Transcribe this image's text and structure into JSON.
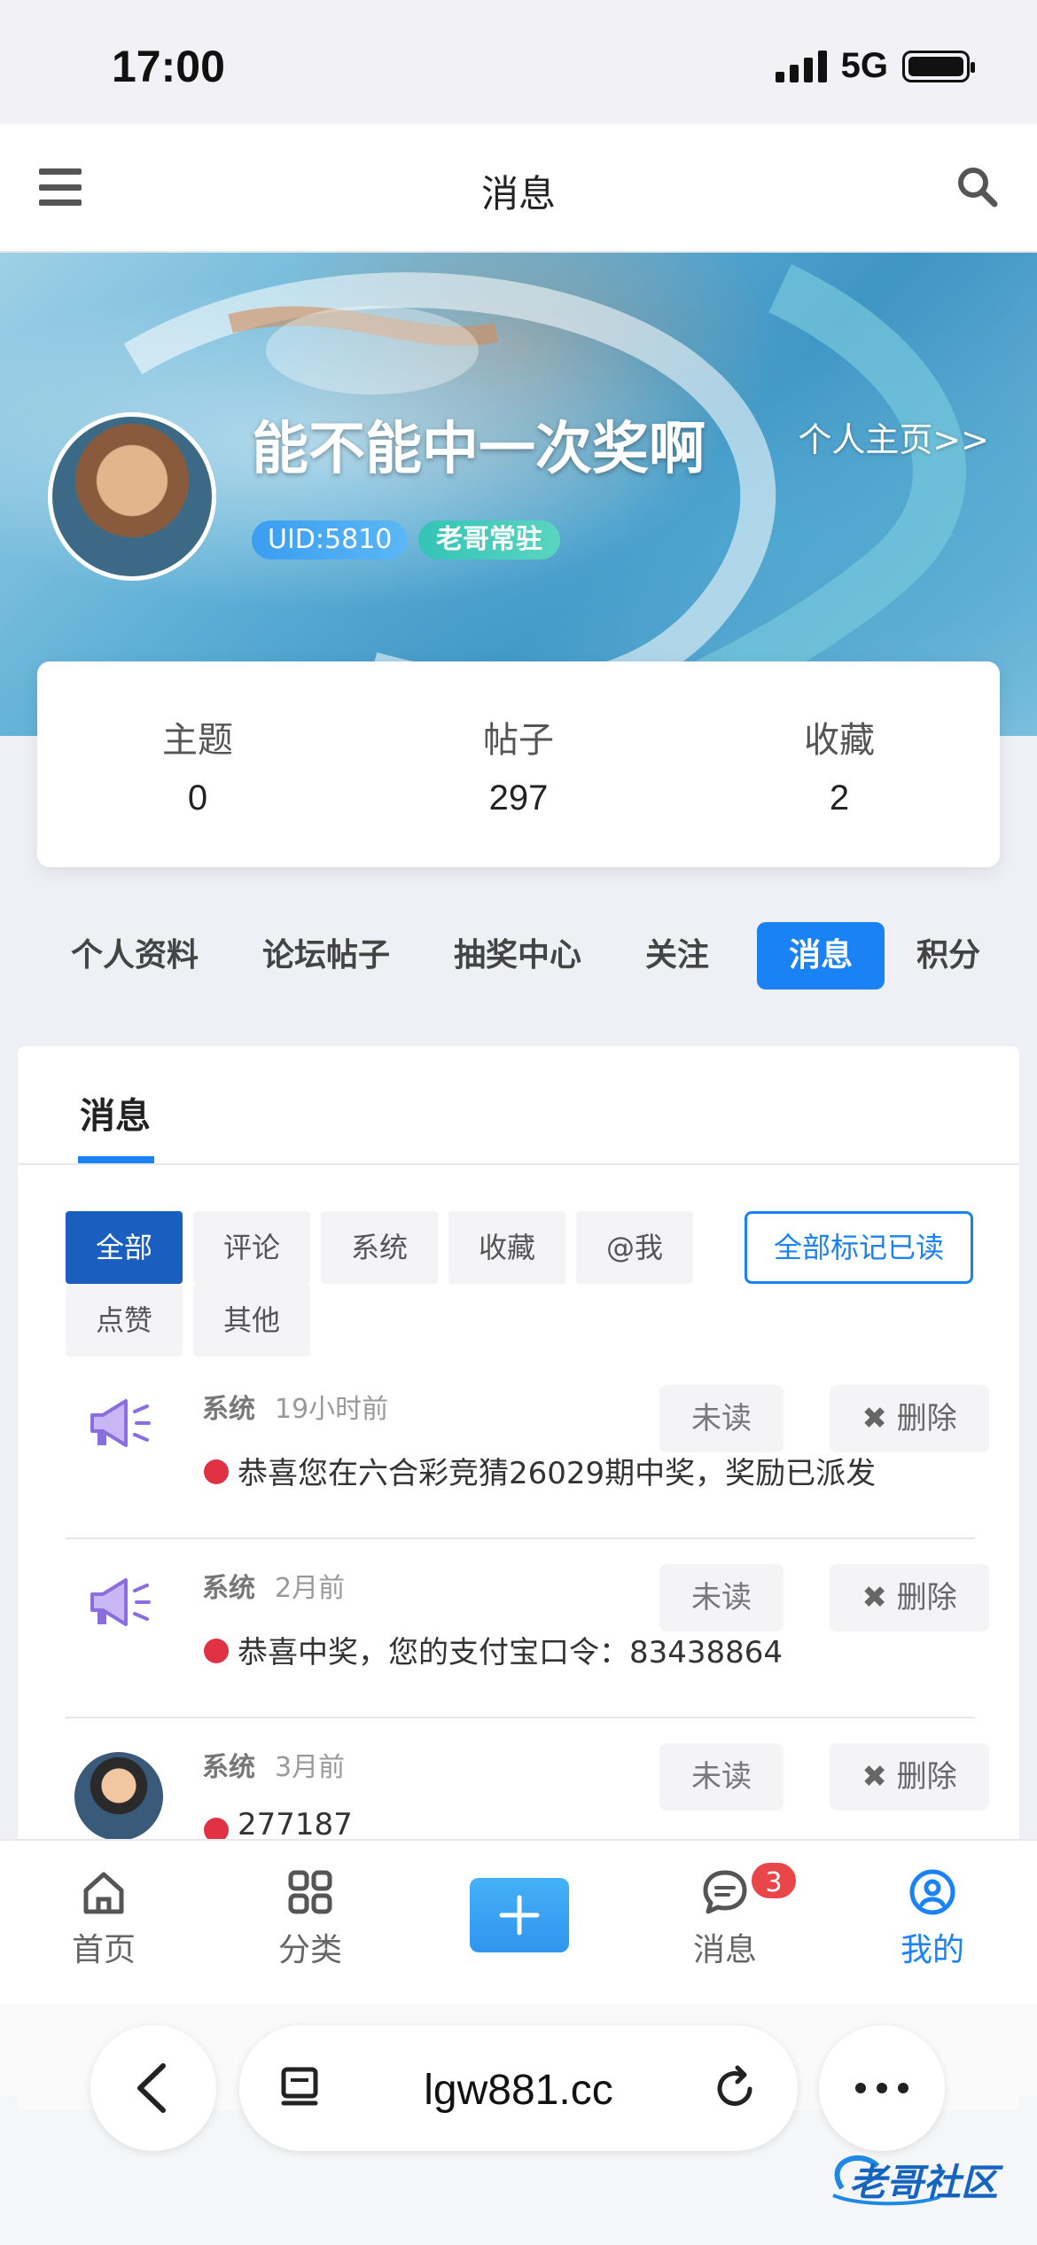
{
  "status_bar": {
    "time": "17:00",
    "network": "5G"
  },
  "header": {
    "title": "消息"
  },
  "profile": {
    "username": "能不能中一次奖啊",
    "profile_link": "个人主页>>",
    "uid": "UID:5810",
    "level": "老哥常驻"
  },
  "stats": [
    {
      "label": "主题",
      "value": "0"
    },
    {
      "label": "帖子",
      "value": "297"
    },
    {
      "label": "收藏",
      "value": "2"
    }
  ],
  "profile_tabs": [
    "个人资料",
    "论坛帖子",
    "抽奖中心",
    "关注",
    "消息",
    "积分"
  ],
  "panel": {
    "tab_title": "消息",
    "filters": [
      "全部",
      "评论",
      "系统",
      "收藏",
      "@我",
      "点赞",
      "其他"
    ],
    "mark_all_read": "全部标记已读",
    "messages": [
      {
        "type": "系统",
        "time": "19小时前",
        "unread_label": "未读",
        "delete_label": "删除",
        "text": "恭喜您在六合彩竞猜26029期中奖，奖励已派发"
      },
      {
        "type": "系统",
        "time": "2月前",
        "unread_label": "未读",
        "delete_label": "删除",
        "text": "恭喜中奖，您的支付宝口令：83438864"
      },
      {
        "type": "系统",
        "time": "3月前",
        "unread_label": "未读",
        "delete_label": "删除",
        "text": "277187"
      }
    ]
  },
  "tabbar": {
    "items": [
      {
        "label": "首页",
        "icon": "home-icon"
      },
      {
        "label": "分类",
        "icon": "grid-icon"
      },
      {
        "label": "消息",
        "icon": "chat-icon",
        "badge": "3"
      },
      {
        "label": "我的",
        "icon": "user-icon"
      }
    ]
  },
  "browser": {
    "url": "lgw881.cc"
  },
  "watermark": "老哥社区",
  "colors": {
    "accent": "#1a82f5",
    "badge": "#e9464a",
    "unread_dot": "#e03242"
  }
}
